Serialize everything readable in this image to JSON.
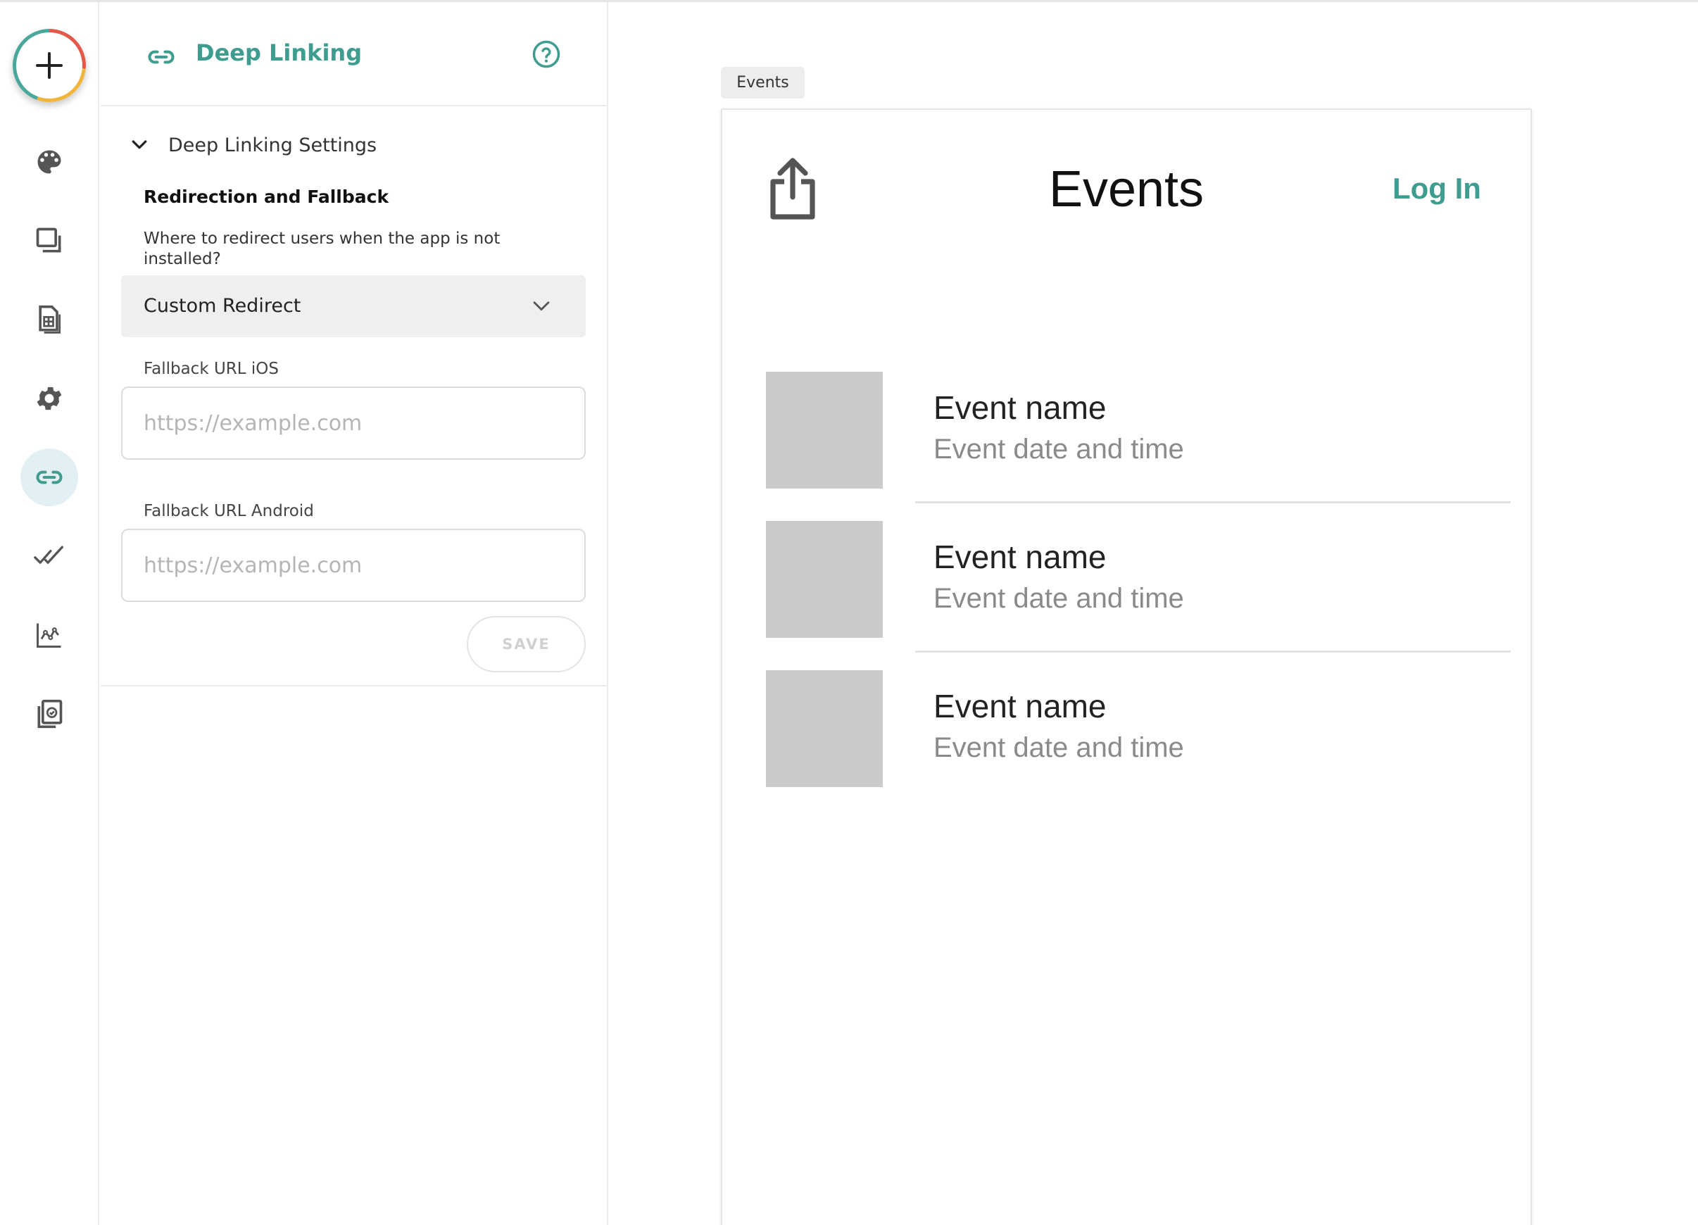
{
  "colors": {
    "accent": "#3f9d8f",
    "rail_active_bg": "#e2f0f4",
    "placeholder_gray": "#cacaca"
  },
  "rail": {
    "add_button": {
      "icon": "plus-icon"
    },
    "items": [
      {
        "icon": "palette-icon",
        "active": false
      },
      {
        "icon": "screens-icon",
        "active": false
      },
      {
        "icon": "data-sheet-icon",
        "active": false
      },
      {
        "icon": "gear-icon",
        "active": false
      },
      {
        "icon": "link-icon",
        "active": true
      },
      {
        "icon": "double-check-icon",
        "active": false
      },
      {
        "icon": "analytics-icon",
        "active": false
      },
      {
        "icon": "publish-icon",
        "active": false
      }
    ]
  },
  "panel": {
    "title": "Deep Linking",
    "section_title": "Deep Linking Settings",
    "subheading": "Redirection and Fallback",
    "help_text": "Where to redirect users when the app is not installed?",
    "redirect_select": {
      "value": "Custom Redirect"
    },
    "ios_field": {
      "label": "Fallback URL iOS",
      "placeholder": "https://example.com",
      "value": ""
    },
    "android_field": {
      "label": "Fallback URL Android",
      "placeholder": "https://example.com",
      "value": ""
    },
    "save_label": "SAVE"
  },
  "preview": {
    "screen_tab": "Events",
    "title": "Events",
    "login_label": "Log In",
    "events": [
      {
        "name": "Event name",
        "date": "Event date and time"
      },
      {
        "name": "Event name",
        "date": "Event date and time"
      },
      {
        "name": "Event name",
        "date": "Event date and time"
      }
    ]
  }
}
